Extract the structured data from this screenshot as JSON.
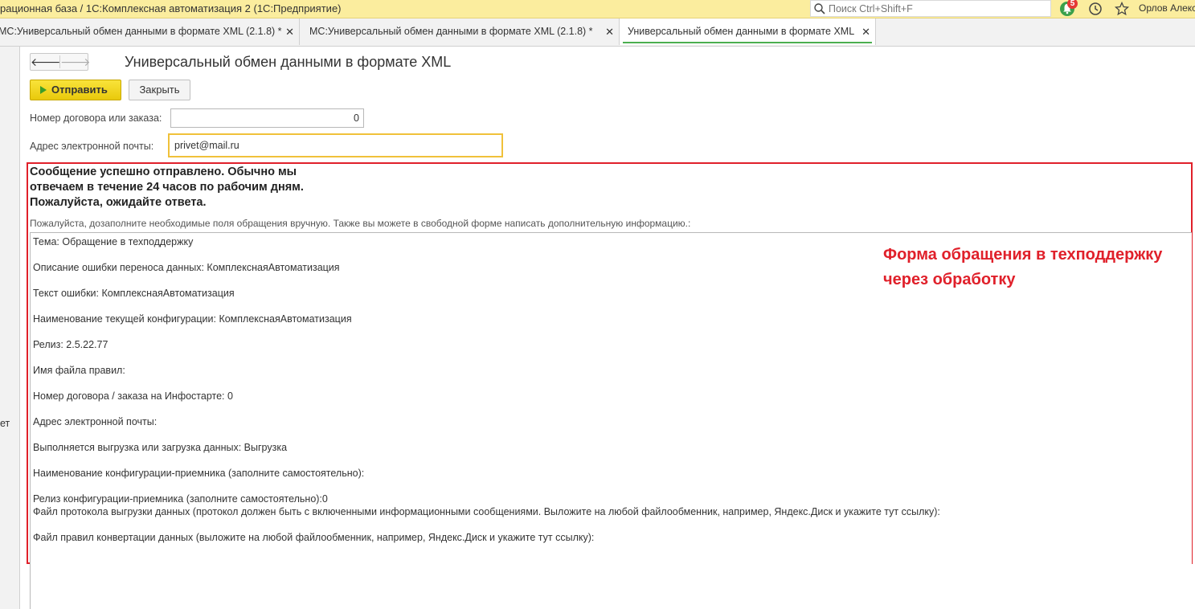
{
  "window": {
    "title": "рационная база / 1С:Комплексная автоматизация 2  (1С:Предприятие)",
    "search_placeholder": "Поиск Ctrl+Shift+F",
    "notifications_count": "5",
    "user_name": "Орлов Алекса"
  },
  "tabs": [
    {
      "label": "МС:Универсальный обмен данными в формате XML (2.1.8) *"
    },
    {
      "label": "МС:Универсальный обмен данными в формате XML (2.1.8) *"
    },
    {
      "label": "Универсальный обмен данными в формате XML",
      "active": true
    }
  ],
  "left_panel": {
    "fragment": "ет"
  },
  "form": {
    "title": "Универсальный обмен данными в формате XML",
    "send_label": "Отправить",
    "close_label": "Закрыть",
    "contract_label": "Номер договора или заказа:",
    "contract_value": "0",
    "email_label": "Адрес электронной почты:",
    "email_value": "privet@mail.ru",
    "success_message": [
      "Сообщение успешно отправлено. Обычно мы",
      "отвечаем в течение 24 часов по рабочим дням.",
      "Пожалуйста, ожидайте ответа."
    ],
    "hint": "Пожалуйста, дозаполните необходимые поля обращения вручную. Также вы можете в свободной форме написать дополнительную информацию.:",
    "request_lines": [
      "Тема: Обращение в техподдержку",
      "Описание ошибки переноса данных: КомплекснаяАвтоматизация",
      "Текст ошибки: КомплекснаяАвтоматизация",
      "Наименование текущей конфигурации: КомплекснаяАвтоматизация",
      "Релиз: 2.5.22.77",
      "Имя файла правил:",
      "Номер договора / заказа на Инфостарте: 0",
      "Адрес электронной почты:",
      "Выполняется выгрузка или загрузка данных: Выгрузка",
      "Наименование конфигурации-приемника (заполните самостоятельно):",
      "Релиз конфигурации-приемника (заполните самостоятельно):0",
      "Файл протокола выгрузки данных (протокол должен быть с включенными информационными сообщениями. Выложите на любой файлообменник, например, Яндекс.Диск и укажите тут ссылку):",
      "Файл правил конвертации данных (выложите на любой файлообменник, например, Яндекс.Диск и укажите тут ссылку):"
    ]
  },
  "annotation": {
    "line1": "Форма обращения в техподдержку",
    "line2": "через обработку",
    "color": "#e0202a"
  }
}
